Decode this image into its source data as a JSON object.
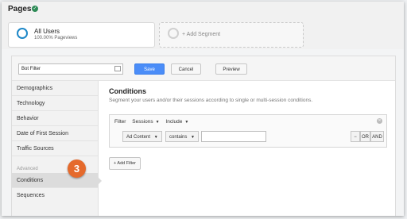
{
  "page": {
    "title": "Pages"
  },
  "segments": {
    "active": {
      "name": "All Users",
      "sub": "100.00% Pageviews"
    },
    "add_label": "+ Add Segment"
  },
  "editor": {
    "name_value": "Bot Filter",
    "save_label": "Save",
    "cancel_label": "Cancel",
    "preview_label": "Preview"
  },
  "sidebar": {
    "items": [
      "Demographics",
      "Technology",
      "Behavior",
      "Date of First Session",
      "Traffic Sources"
    ],
    "advanced_label": "Advanced",
    "advanced_items": [
      "Conditions",
      "Sequences"
    ],
    "active_item": "Conditions"
  },
  "step_badge": "3",
  "conditions": {
    "title": "Conditions",
    "description": "Segment your users and/or their sessions according to single or multi-session conditions.",
    "filter_label": "Filter",
    "scope_value": "Sessions",
    "mode_value": "Include",
    "dimension_value": "Ad Content",
    "operator_value": "contains",
    "match_value": "",
    "minus_label": "−",
    "or_label": "OR",
    "and_label": "AND",
    "add_filter_label": "+ Add Filter"
  },
  "colors": {
    "accent": "#4b8df8",
    "badge": "#e56a2c",
    "ring": "#1e88c8"
  }
}
